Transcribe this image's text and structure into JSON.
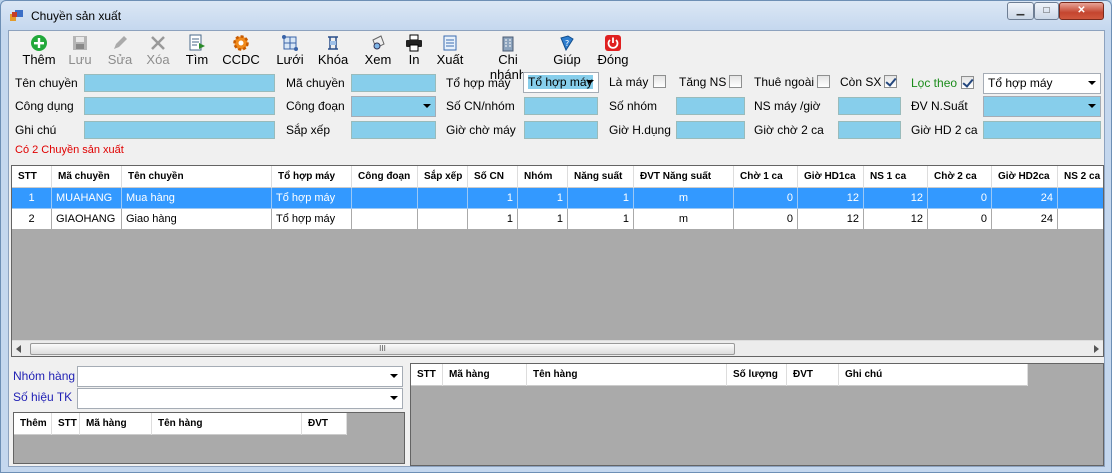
{
  "window": {
    "title": "Chuyền sản xuất",
    "buttons": {
      "minimize": "▁",
      "maximize": "□",
      "close": "✕"
    }
  },
  "toolbar": {
    "add": "Thêm",
    "save": "Lưu",
    "edit": "Sửa",
    "delete": "Xóa",
    "find": "Tìm",
    "tools": "CCDC",
    "grid": "Lưới",
    "lock": "Khóa",
    "view": "Xem",
    "print": "In",
    "export": "Xuất",
    "branch": "Chi nhánh",
    "help": "Giúp",
    "close": "Đóng"
  },
  "form": {
    "ten_chuyen": {
      "label": "Tên chuyền",
      "value": ""
    },
    "cong_dung": {
      "label": "Công dụng",
      "value": ""
    },
    "ghi_chu": {
      "label": "Ghi chú",
      "value": ""
    },
    "ma_chuyen": {
      "label": "Mã chuyền",
      "value": ""
    },
    "cong_doan": {
      "label": "Công đoạn",
      "value": ""
    },
    "sap_xep": {
      "label": "Sắp xếp",
      "value": ""
    },
    "to_hop_may": {
      "label": "Tổ hợp máy",
      "value": "Tổ hợp máy"
    },
    "so_cn_nhom": {
      "label": "Số CN/nhóm",
      "value": ""
    },
    "gio_cho_may": {
      "label": "Giờ chờ máy",
      "value": ""
    },
    "la_may": {
      "label": "Là máy",
      "checked": false
    },
    "so_nhom": {
      "label": "Số nhóm",
      "value": ""
    },
    "gio_h_dung": {
      "label": "Giờ H.dụng",
      "value": ""
    },
    "tang_ns": {
      "label": "Tăng NS",
      "checked": false
    },
    "thue_ngoai": {
      "label": "Thuê ngoài",
      "checked": false
    },
    "con_sx": {
      "label": "Còn SX",
      "checked": true
    },
    "ns_may_gio": {
      "label": "NS máy /giờ",
      "value": ""
    },
    "gio_cho_2_ca": {
      "label": "Giờ chờ 2 ca",
      "value": ""
    },
    "loc_theo": {
      "label": "Lọc theo",
      "checked": true,
      "value": "Tổ hợp máy"
    },
    "dv_n_suat": {
      "label": "ĐV N.Suất",
      "value": ""
    },
    "gio_hd_2_ca": {
      "label": "Giờ HD 2 ca",
      "value": ""
    }
  },
  "status": "Có 2 Chuyền sản xuất",
  "main_grid": {
    "columns": [
      "STT",
      "Mã chuyền",
      "Tên chuyền",
      "Tổ hợp máy",
      "Công đoạn",
      "Sắp xếp",
      "Số CN",
      "Nhóm",
      "Năng suất",
      "ĐVT Năng suất",
      "Chờ 1 ca",
      "Giờ HD1ca",
      "NS 1 ca",
      "Chờ 2 ca",
      "Giờ HD2ca",
      "NS 2 ca"
    ],
    "rows": [
      [
        "1",
        "MUAHANG",
        "Mua hàng",
        "Tổ hợp máy",
        "",
        "",
        "1",
        "1",
        "1",
        "m",
        "0",
        "12",
        "12",
        "0",
        "24",
        ""
      ],
      [
        "2",
        "GIAOHANG",
        "Giao hàng",
        "Tổ hợp máy",
        "",
        "",
        "1",
        "1",
        "1",
        "m",
        "0",
        "12",
        "12",
        "0",
        "24",
        ""
      ]
    ],
    "scroll_glyph": "III"
  },
  "bottom_left": {
    "nhom_hang": {
      "label": "Nhóm hàng",
      "value": ""
    },
    "so_hieu_tk": {
      "label": "Số hiệu TK",
      "value": ""
    },
    "columns": [
      "Thêm",
      "STT",
      "Mã hàng",
      "Tên hàng",
      "ĐVT"
    ]
  },
  "bottom_right": {
    "columns": [
      "STT",
      "Mã hàng",
      "Tên hàng",
      "Số lượng",
      "ĐVT",
      "Ghi chú"
    ]
  },
  "colors": {
    "input_bg": "#87ceeb",
    "selection": "#3399ff",
    "status": "#e00000",
    "label_blue": "#1f1fb4",
    "label_green": "#1b8c1b"
  }
}
